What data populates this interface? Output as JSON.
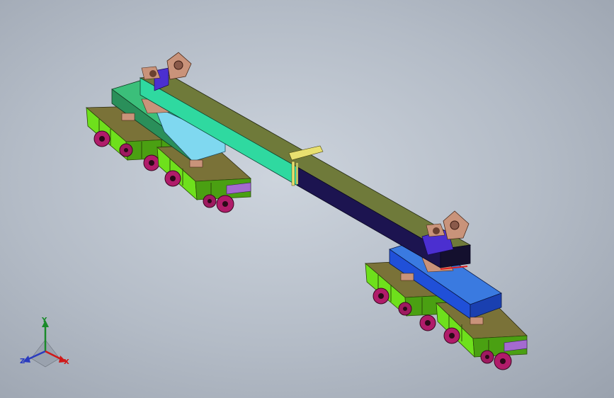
{
  "viewport": {
    "background_center": "#cdd4dd",
    "background_edge": "#9aa2ae"
  },
  "colors": {
    "bogie_green": "#6ee01c",
    "bogie_dark": "#4aa012",
    "bogie_top": "#7a7238",
    "wheel_magenta": "#b01c6a",
    "beam_top": "#6f7a3a",
    "beam_teal": "#2fd9a0",
    "beam_navy": "#1c1450",
    "bolster_green": "#3bbf7a",
    "bolster_blue": "#2050d8",
    "bolster_cyan": "#7fd8f0",
    "lug_tan": "#c9937a",
    "pad_purple": "#4b2fd0"
  },
  "triad": {
    "y": "Y",
    "z": "Z",
    "x": "X",
    "y_color": "#1a8a2a",
    "z_color": "#2a3bbf",
    "x_color": "#d01818"
  }
}
